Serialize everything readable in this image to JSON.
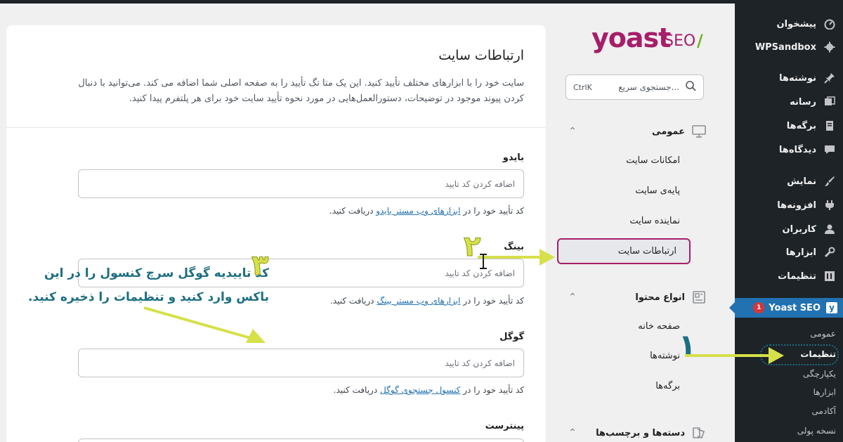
{
  "wp_sidebar": {
    "items": [
      {
        "label": "پیشخوان",
        "icon": "dashboard-icon"
      },
      {
        "label": "WPSandbox",
        "icon": "gear-icon"
      },
      {
        "label": "نوشته‌ها",
        "icon": "pin-icon"
      },
      {
        "label": "رسانه",
        "icon": "media-icon"
      },
      {
        "label": "برگه‌ها",
        "icon": "page-icon"
      },
      {
        "label": "دیدگاه‌ها",
        "icon": "comment-icon"
      },
      {
        "label": "نمایش",
        "icon": "brush-icon"
      },
      {
        "label": "افزونه‌ها",
        "icon": "plugin-icon"
      },
      {
        "label": "کاربران",
        "icon": "user-icon"
      },
      {
        "label": "ابزارها",
        "icon": "wrench-icon"
      },
      {
        "label": "تنظیمات",
        "icon": "settings-icon"
      }
    ],
    "active": {
      "label": "Yoast SEO",
      "badge": "1",
      "icon": "yoast-icon"
    },
    "subitems": [
      "عمومی",
      "تنظیمات",
      "یکپارچگی",
      "ابزارها",
      "آکادمی",
      "نسخه پولی"
    ]
  },
  "yoast_nav": {
    "logo_main": "yoast",
    "logo_seo": "SEO",
    "logo_slash": "/",
    "search": {
      "placeholder": "جستجوی سریع...",
      "shortcut": "CtrlK"
    },
    "groups": [
      {
        "title": "عمومی",
        "icon": "monitor-icon",
        "items": [
          "امکانات سایت",
          "پایه‌ی سایت",
          "نماینده سایت",
          "ارتباطات سایت"
        ]
      },
      {
        "title": "انواع محتوا",
        "icon": "content-types-icon",
        "items": [
          "صفحه خانه",
          "نوشته‌ها",
          "برگه‌ها"
        ]
      },
      {
        "title": "دسته‌ها و برچسب‌ها",
        "icon": "tags-icon",
        "items": []
      }
    ],
    "active_item": "ارتباطات سایت"
  },
  "main": {
    "title": "ارتباطات سایت",
    "description": "سایت خود را با ابزارهای مختلف تأیید کنید. این یک متا تگ تأیید را به صفحه اصلی شما اضافه می کند. می‌توانید با دنبال کردن پیوند موجود در توضیحات، دستورالعمل‌هایی در مورد نحوه تأیید سایت خود برای هر پلتفرم پیدا کنید.",
    "fields": [
      {
        "label": "بایدو",
        "placeholder": "اضافه کردن کد تایید",
        "help_pre": "کد تأیید خود را در",
        "help_link": "ابزارهای وب مستر بایدو",
        "help_post": "دریافت کنید."
      },
      {
        "label": "بینگ",
        "placeholder": "اضافه کردن کد تایید",
        "help_pre": "کد تأیید خود را در",
        "help_link": "ابزارهای وب مستر بینگ",
        "help_post": "دریافت کنید."
      },
      {
        "label": "گوگل",
        "placeholder": "اضافه کردن کد تایید",
        "help_pre": "کد تأیید خود را در",
        "help_link": "کنسول جستجوی گوگل",
        "help_post": "دریافت کنید."
      },
      {
        "label": "پینترست"
      }
    ]
  },
  "annotations": {
    "instruction": "کد تاییدیه گوگل سرچ کنسول را در این باکس وارد کنید و تنظیمات را ذخیره کنید.",
    "step1": "۱",
    "step2": "۲",
    "step3": "۳",
    "colors": {
      "teal": "#1c6e82",
      "lime": "#d6e04a",
      "brand": "#a61e69"
    }
  }
}
